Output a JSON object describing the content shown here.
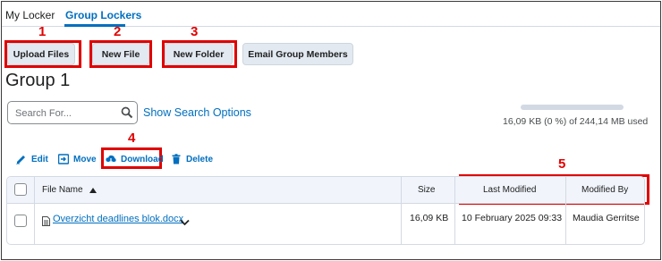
{
  "tabs": [
    {
      "label": "My Locker",
      "active": false
    },
    {
      "label": "Group Lockers",
      "active": true
    }
  ],
  "actions": {
    "upload": "Upload Files",
    "new_file": "New File",
    "new_folder": "New Folder",
    "email": "Email Group Members"
  },
  "annotations": [
    "1",
    "2",
    "3",
    "4",
    "5"
  ],
  "page_title": "Group 1",
  "search": {
    "placeholder": "Search For...",
    "show_options": "Show Search Options"
  },
  "storage": {
    "text": "16,09 KB (0 %) of 244,14 MB used",
    "fraction": 0.0
  },
  "toolbar": {
    "edit": "Edit",
    "move": "Move",
    "download": "Download",
    "delete": "Delete"
  },
  "table": {
    "columns": {
      "name": "File Name",
      "size": "Size",
      "modified": "Last Modified",
      "modified_by": "Modified By"
    },
    "rows": [
      {
        "name": "Overzicht deadlines blok.docx",
        "size": "16,09 KB",
        "modified": "10 February 2025 09:33",
        "modified_by": "Maudia Gerritse"
      }
    ]
  },
  "colors": {
    "accent": "#006fbf",
    "highlight": "#e00000"
  }
}
